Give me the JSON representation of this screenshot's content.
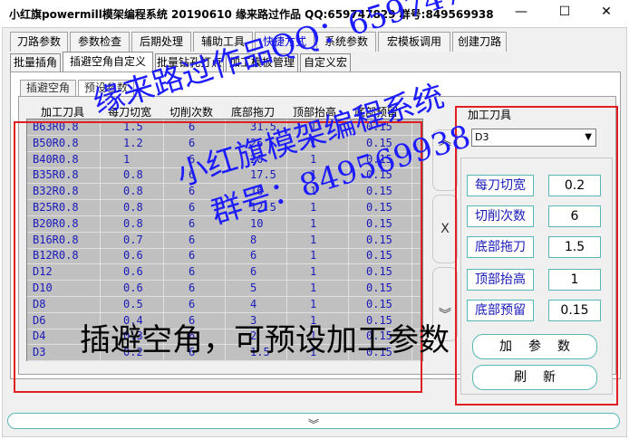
{
  "window": {
    "title": "小红旗powermill模架编程系统 20190610   缘来路过作品 QQ:659747829  群号:849569938",
    "minimize": "—",
    "maximize": "☐",
    "close": "✕"
  },
  "tabs_main": [
    "刀路参数",
    "参数检查",
    "后期处理",
    "辅助工具",
    "快捷方式",
    "系统参数",
    "宏模板调用",
    "创建刀路"
  ],
  "tabs_sub": [
    "批量插角",
    "插避空角自定义",
    "批量钻孔打点",
    "加工模板管理",
    "自定义宏"
  ],
  "tabs_inner": [
    "插避空角",
    "预设参数"
  ],
  "grid": {
    "headers": [
      "加工刀具",
      "每刀切宽",
      "切削次数",
      "底部拖刀",
      "顶部抬高",
      "底部预留"
    ],
    "rows": [
      [
        "B63R0.8",
        "1.5",
        "6",
        "31.5",
        "1",
        "0.15"
      ],
      [
        "B50R0.8",
        "1.2",
        "6",
        "25",
        "1",
        "0.15"
      ],
      [
        "B40R0.8",
        "1",
        "6",
        "20",
        "1",
        "0.15"
      ],
      [
        "B35R0.8",
        "0.8",
        "6",
        "17.5",
        "1",
        "0.15"
      ],
      [
        "B32R0.8",
        "0.8",
        "6",
        "16",
        "1",
        "0.15"
      ],
      [
        "B25R0.8",
        "0.8",
        "6",
        "12.5",
        "1",
        "0.15"
      ],
      [
        "B20R0.8",
        "0.8",
        "6",
        "10",
        "1",
        "0.15"
      ],
      [
        "B16R0.8",
        "0.7",
        "6",
        "8",
        "1",
        "0.15"
      ],
      [
        "B12R0.8",
        "0.6",
        "6",
        "6",
        "1",
        "0.15"
      ],
      [
        "D12",
        "0.6",
        "6",
        "6",
        "1",
        "0.15"
      ],
      [
        "D10",
        "0.6",
        "6",
        "5",
        "1",
        "0.15"
      ],
      [
        "D8",
        "0.5",
        "6",
        "4",
        "1",
        "0.15"
      ],
      [
        "D6",
        "0.4",
        "6",
        "3",
        "1",
        "0.15"
      ],
      [
        "D4",
        "0.3",
        "6",
        "2",
        "1",
        "0.15"
      ],
      [
        "D3",
        "0.2",
        "6",
        "1.5",
        "1",
        "0.15"
      ]
    ]
  },
  "side_buttons": {
    "up": "︽",
    "delete": "X",
    "down": "︾"
  },
  "right_panel": {
    "tool_label": "加工刀具",
    "tool_value": "D3",
    "params": [
      {
        "label": "每刀切宽",
        "value": "0.2"
      },
      {
        "label": "切削次数",
        "value": "6"
      },
      {
        "label": "底部拖刀",
        "value": "1.5"
      },
      {
        "label": "顶部抬高",
        "value": "1"
      },
      {
        "label": "底部预留",
        "value": "0.15"
      }
    ],
    "add_button": "加参数",
    "refresh_button": "刷新"
  },
  "bottom_chevron": "︾",
  "watermarks": [
    "缘来路过作品QQ：659747829",
    "小红旗模架编程系统",
    "群号：849569938"
  ],
  "caption": "插避空角，可预设加工参数"
}
